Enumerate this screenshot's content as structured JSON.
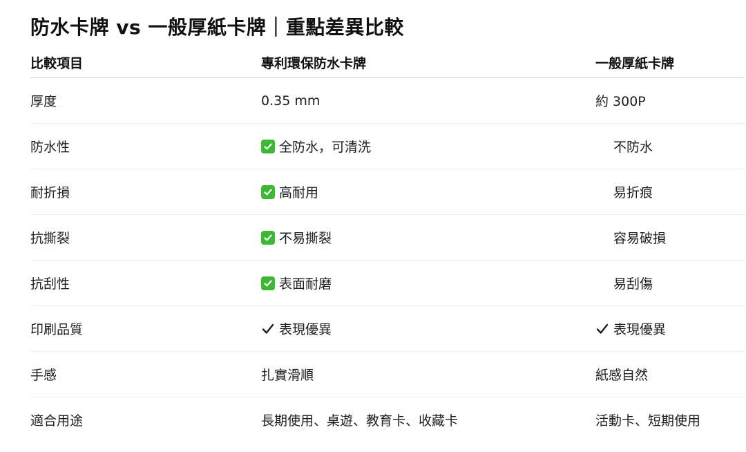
{
  "title": "防水卡牌 vs 一般厚紙卡牌｜重點差異比較",
  "colors": {
    "check_box_green": "#3db832",
    "divider": "#ececee",
    "header_divider": "#d4d4d8"
  },
  "columns": [
    "比較項目",
    "專利環保防水卡牌",
    "一般厚紙卡牌"
  ],
  "rows": [
    {
      "item": "厚度",
      "waterproof": {
        "text": "0.35 mm",
        "icon": "none"
      },
      "paper": {
        "text": "約 300P",
        "icon": "none"
      }
    },
    {
      "item": "防水性",
      "waterproof": {
        "text": "全防水，可清洗",
        "icon": "green-check-box-icon"
      },
      "paper": {
        "text": "不防水",
        "icon": "none"
      }
    },
    {
      "item": "耐折損",
      "waterproof": {
        "text": "高耐用",
        "icon": "green-check-box-icon"
      },
      "paper": {
        "text": "易折痕",
        "icon": "none"
      }
    },
    {
      "item": "抗撕裂",
      "waterproof": {
        "text": "不易撕裂",
        "icon": "green-check-box-icon"
      },
      "paper": {
        "text": "容易破損",
        "icon": "none"
      }
    },
    {
      "item": "抗刮性",
      "waterproof": {
        "text": "表面耐磨",
        "icon": "green-check-box-icon"
      },
      "paper": {
        "text": "易刮傷",
        "icon": "none"
      }
    },
    {
      "item": "印刷品質",
      "waterproof": {
        "text": "表現優異",
        "icon": "check-mark-icon"
      },
      "paper": {
        "text": "表現優異",
        "icon": "check-mark-icon"
      }
    },
    {
      "item": "手感",
      "waterproof": {
        "text": "扎實滑順",
        "icon": "none"
      },
      "paper": {
        "text": "紙感自然",
        "icon": "none"
      }
    },
    {
      "item": "適合用途",
      "waterproof": {
        "text": "長期使用、桌遊、教育卡、收藏卡",
        "icon": "none"
      },
      "paper": {
        "text": "活動卡、短期使用",
        "icon": "none"
      }
    }
  ]
}
